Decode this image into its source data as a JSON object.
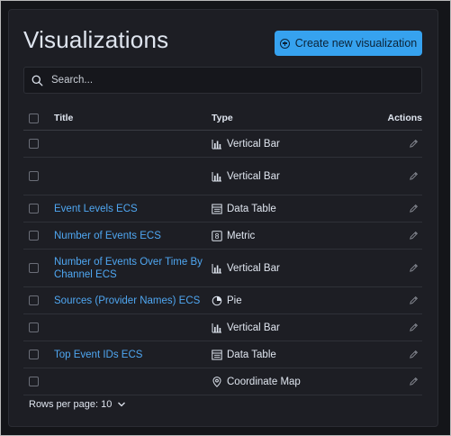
{
  "page": {
    "title": "Visualizations",
    "create_button": "Create new visualization",
    "search_placeholder": "Search..."
  },
  "table": {
    "headers": {
      "title": "Title",
      "type": "Type",
      "actions": "Actions"
    },
    "rows": [
      {
        "title": "",
        "type": "Vertical Bar",
        "type_icon": "vertical-bar-icon"
      },
      {
        "title": "",
        "type": "Vertical Bar",
        "type_icon": "vertical-bar-icon"
      },
      {
        "title": "Event Levels ECS",
        "type": "Data Table",
        "type_icon": "data-table-icon"
      },
      {
        "title": "Number of Events ECS",
        "type": "Metric",
        "type_icon": "metric-icon"
      },
      {
        "title": "Number of Events Over Time By Channel ECS",
        "type": "Vertical Bar",
        "type_icon": "vertical-bar-icon"
      },
      {
        "title": "Sources (Provider Names) ECS",
        "type": "Pie",
        "type_icon": "pie-icon"
      },
      {
        "title": "",
        "type": "Vertical Bar",
        "type_icon": "vertical-bar-icon"
      },
      {
        "title": "Top Event IDs ECS",
        "type": "Data Table",
        "type_icon": "data-table-icon"
      },
      {
        "title": "",
        "type": "Coordinate Map",
        "type_icon": "coordinate-map-icon"
      }
    ]
  },
  "pagination": {
    "rows_per_page": "Rows per page: 10"
  },
  "colors": {
    "accent": "#36a2ef",
    "link": "#4fa7f2",
    "background": "#1d1e24"
  }
}
